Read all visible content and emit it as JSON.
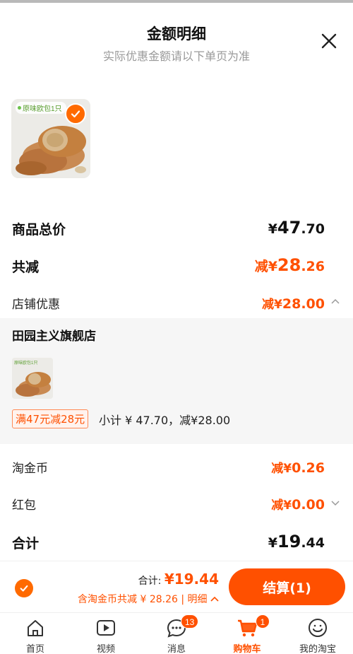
{
  "header": {
    "title": "金额明细",
    "subtitle": "实际优惠金额请以下单页为准"
  },
  "product": {
    "thumb_tag": "原味欧包1只"
  },
  "rows": {
    "total_price_label": "商品总价",
    "total_price_yen": "¥",
    "total_price_int": "47",
    "total_price_dec": ".70",
    "discount_label": "共减",
    "discount_prefix": "减¥",
    "discount_int": "28",
    "discount_dec": ".26",
    "store_discount_label": "店铺优惠",
    "store_discount_prefix": "减¥",
    "store_discount_value": "28.00",
    "taojinbi_label": "淘金币",
    "taojinbi_prefix": "减¥",
    "taojinbi_value": "0.26",
    "redpacket_label": "红包",
    "redpacket_prefix": "减¥",
    "redpacket_value": "0.00",
    "sum_label": "合计",
    "sum_yen": "¥",
    "sum_int": "19",
    "sum_dec": ".44"
  },
  "store": {
    "name": "田园主义旗舰店",
    "thumb_tag": "原味欧包1只",
    "promo_badge": "满47元减28元",
    "subtotal": "小计 ¥ 47.70，减¥28.00"
  },
  "footer": {
    "total_label": "合计:",
    "total_amount": "¥19.44",
    "savings_text": "含淘金币共减 ¥ 28.26 | 明细",
    "checkout_label": "结算(1)"
  },
  "tabbar": {
    "items": [
      {
        "label": "首页",
        "icon": "home-icon"
      },
      {
        "label": "视频",
        "icon": "video-icon"
      },
      {
        "label": "消息",
        "icon": "message-icon",
        "badge": "13"
      },
      {
        "label": "购物车",
        "icon": "cart-icon",
        "badge": "1",
        "active": true
      },
      {
        "label": "我的淘宝",
        "icon": "profile-icon"
      }
    ]
  },
  "colors": {
    "accent": "#ff5000",
    "check": "#ff6a00",
    "muted": "#999999"
  }
}
